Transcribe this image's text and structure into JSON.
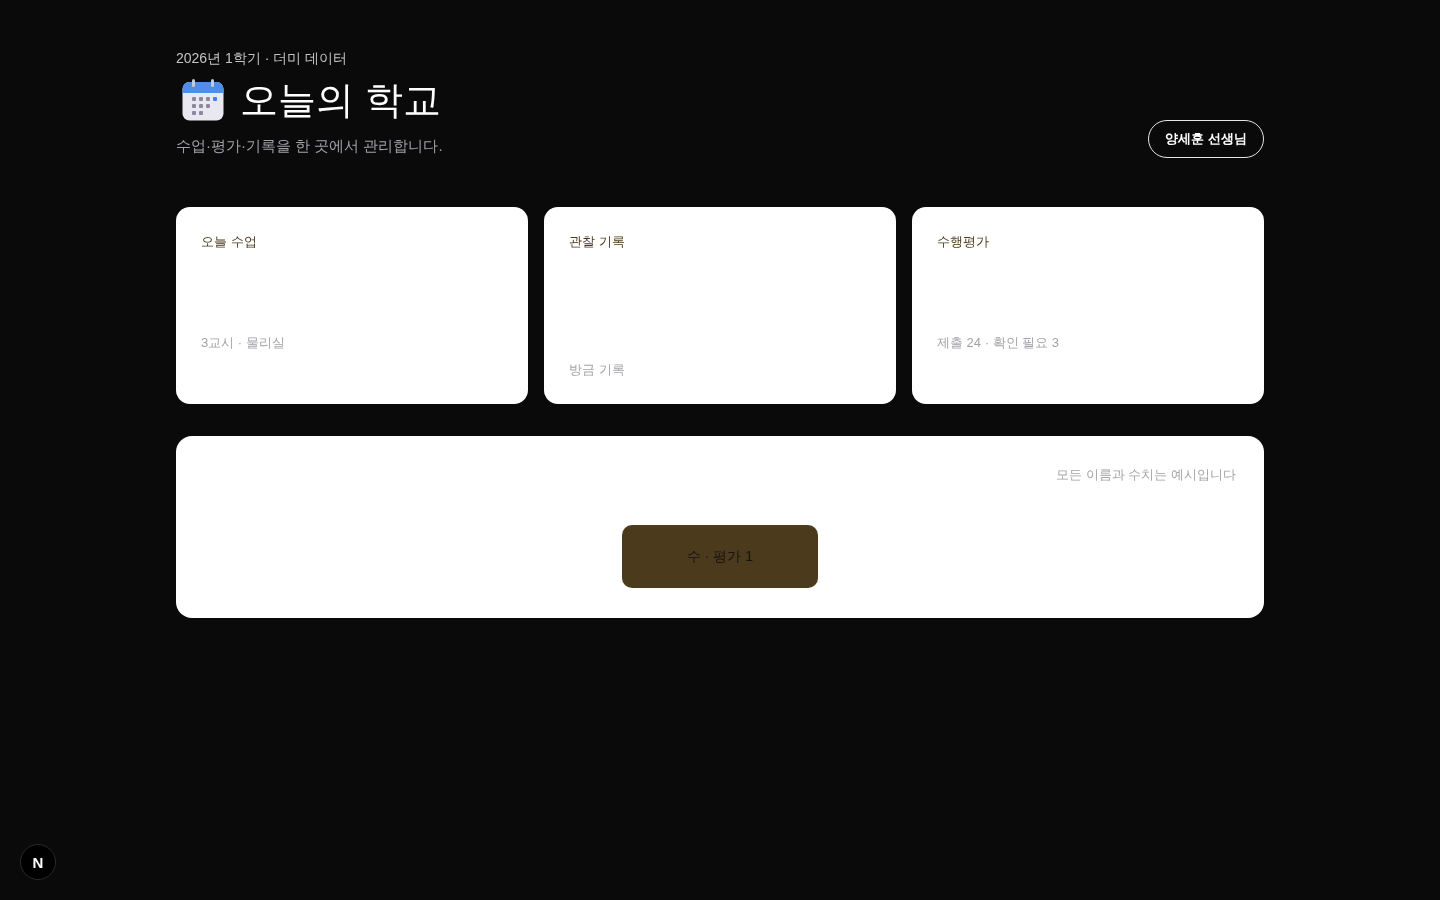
{
  "header": {
    "eyebrow": "2026년 1학기 · 더미 데이터",
    "title": "오늘의 학교",
    "subtitle": "수업·평가·기록을 한 곳에서 관리합니다.",
    "user_button": "양세훈 선생님"
  },
  "cards": [
    {
      "title": "오늘 수업",
      "note": "3교시 · 물리실"
    },
    {
      "title": "관찰 기록",
      "note": "방금 기록"
    },
    {
      "title": "수행평가",
      "note": "제출 24 · 확인 필요 3"
    }
  ],
  "panel": {
    "note": "모든 이름과 수치는 예시입니다",
    "button": "수 · 평가 1"
  },
  "dev_indicator": {
    "label": "N"
  }
}
